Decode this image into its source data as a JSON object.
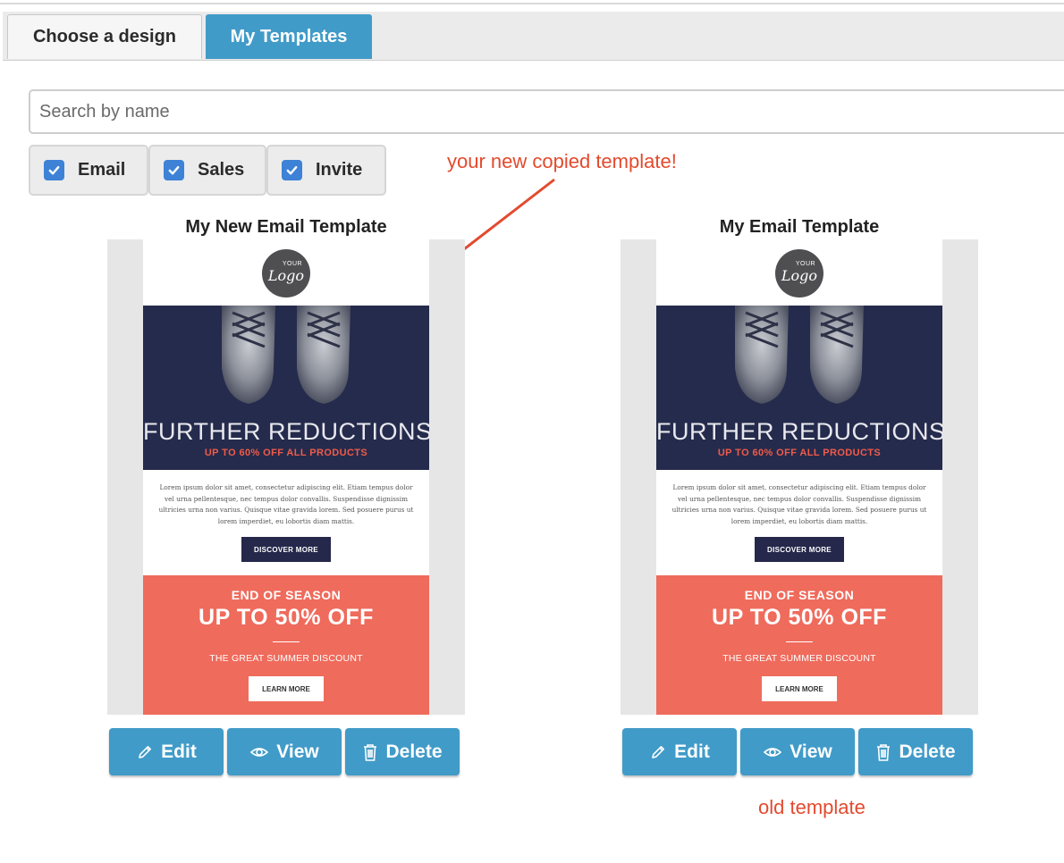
{
  "tabs": [
    {
      "label": "Choose a design",
      "active": false
    },
    {
      "label": "My Templates",
      "active": true
    }
  ],
  "search": {
    "placeholder": "Search by name",
    "value": ""
  },
  "filters": [
    {
      "label": "Email",
      "checked": true
    },
    {
      "label": "Sales",
      "checked": true
    },
    {
      "label": "Invite",
      "checked": true
    }
  ],
  "annotations": {
    "new_copy": "your new copied template!",
    "old": "old template"
  },
  "templates": [
    {
      "title": "My New Email Template",
      "preview": {
        "logo_small": "YOUR",
        "logo_large": "Logo",
        "hero_title": "FURTHER REDUCTIONS",
        "hero_subtitle": "UP TO 60% OFF ALL PRODUCTS",
        "body_text": "Lorem ipsum dolor sit amet, consectetur adipiscing elit. Etiam tempus dolor vel urna pellentesque, nec tempus dolor convallis. Suspendisse dignissim ultricies urna non varius. Quisque vitae gravida lorem. Sed posuere purus ut lorem imperdiet, eu lobortis diam mattis.",
        "cta_dark": "DISCOVER MORE",
        "promo_kicker": "END OF SEASON",
        "promo_headline": "UP TO 50% OFF",
        "promo_sub": "THE GREAT SUMMER DISCOUNT",
        "cta_light": "LEARN MORE"
      },
      "actions": {
        "edit": "Edit",
        "view": "View",
        "delete": "Delete"
      }
    },
    {
      "title": "My Email Template",
      "preview": {
        "logo_small": "YOUR",
        "logo_large": "Logo",
        "hero_title": "FURTHER REDUCTIONS",
        "hero_subtitle": "UP TO 60% OFF ALL PRODUCTS",
        "body_text": "Lorem ipsum dolor sit amet, consectetur adipiscing elit. Etiam tempus dolor vel urna pellentesque, nec tempus dolor convallis. Suspendisse dignissim ultricies urna non varius. Quisque vitae gravida lorem. Sed posuere purus ut lorem imperdiet, eu lobortis diam mattis.",
        "cta_dark": "DISCOVER MORE",
        "promo_kicker": "END OF SEASON",
        "promo_headline": "UP TO 50% OFF",
        "promo_sub": "THE GREAT SUMMER DISCOUNT",
        "cta_light": "LEARN MORE"
      },
      "actions": {
        "edit": "Edit",
        "view": "View",
        "delete": "Delete"
      }
    }
  ],
  "colors": {
    "accent": "#419bc8",
    "annotation": "#e34a2e",
    "hero_bg": "#252b4c",
    "promo_bg": "#ef6b5c",
    "checkbox": "#3d82d6"
  }
}
